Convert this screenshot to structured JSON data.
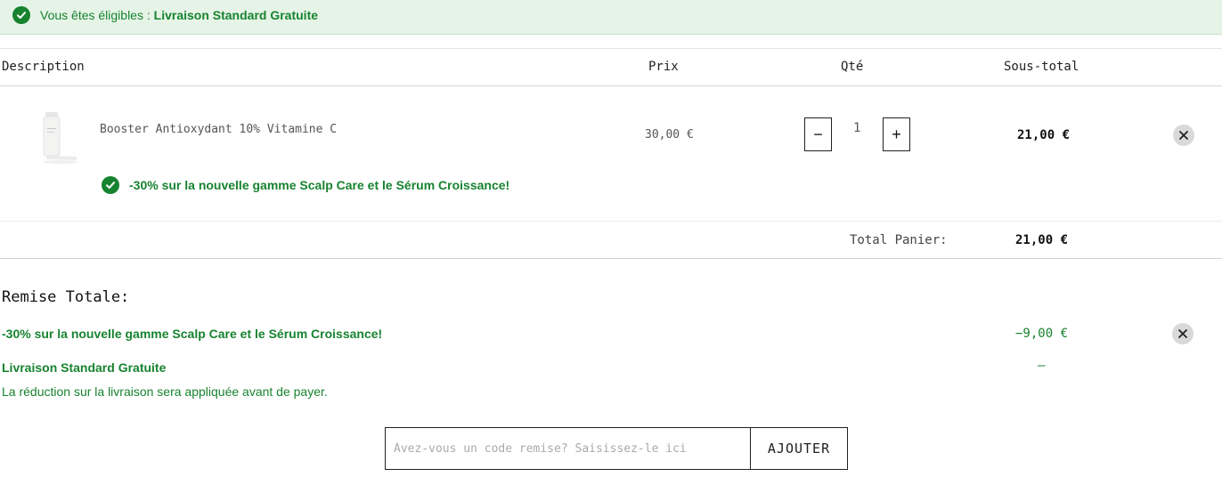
{
  "banner": {
    "prefix": "Vous êtes éligibles : ",
    "highlight": "Livraison Standard Gratuite",
    "icon": "check-circle-icon"
  },
  "table": {
    "headers": {
      "description": "Description",
      "price": "Prix",
      "qty": "Qté",
      "subtotal": "Sous-total"
    }
  },
  "item": {
    "name": "Booster Antioxydant 10% Vitamine C",
    "price": "30,00 €",
    "quantity": "1",
    "minus": "−",
    "plus": "+",
    "subtotal": "21,00 €",
    "promo": "-30% sur la nouvelle gamme Scalp Care et le Sérum Croissance!"
  },
  "totals": {
    "label": "Total Panier:",
    "value": "21,00 €"
  },
  "discount": {
    "title": "Remise Totale:",
    "promo_label": "-30% sur la nouvelle gamme Scalp Care et le Sérum Croissance!",
    "promo_amount": "−9,00 €",
    "shipping_label": "Livraison Standard Gratuite",
    "shipping_amount": "–",
    "shipping_note": "La réduction sur la livraison sera appliquée avant de payer."
  },
  "coupon": {
    "placeholder": "Avez-vous un code remise? Saisissez-le ici",
    "button": "AJOUTER"
  },
  "colors": {
    "success": "#17832f",
    "banner_bg": "#e6f4e8",
    "remove_bg": "#d9d9d9"
  }
}
